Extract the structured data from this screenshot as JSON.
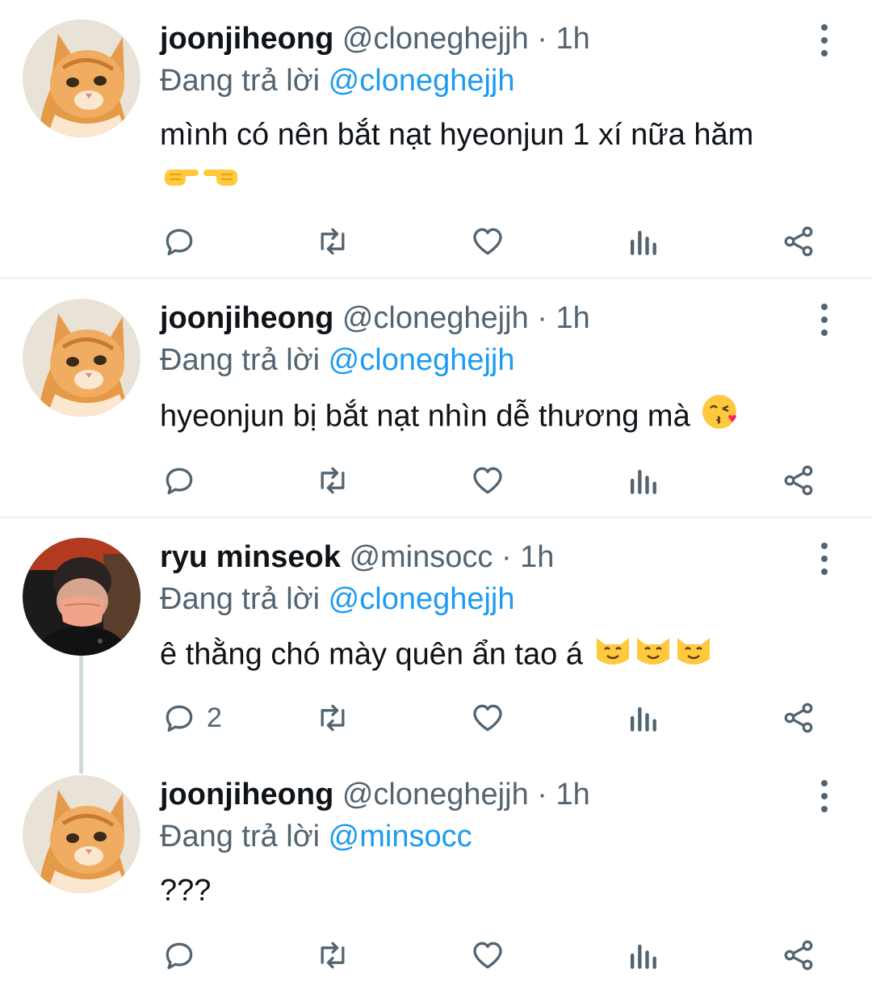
{
  "tweets": [
    {
      "name": "joonjiheong",
      "handle": "@cloneghejjh",
      "dot": "·",
      "time": "1h",
      "replying_prefix": "Đang trả lời",
      "replying_to": "@cloneghejjh",
      "text": "mình có nên bắt nạt hyeonjun 1 xí nữa hăm",
      "emoji": [
        "pointing-right-emoji",
        "pointing-left-emoji"
      ],
      "reply_count": ""
    },
    {
      "name": "joonjiheong",
      "handle": "@cloneghejjh",
      "dot": "·",
      "time": "1h",
      "replying_prefix": "Đang trả lời",
      "replying_to": "@cloneghejjh",
      "text": "hyeonjun bị bắt nạt nhìn dễ thương mà",
      "emoji": [
        "kissing-heart-emoji"
      ],
      "reply_count": ""
    },
    {
      "name": "ryu minseok",
      "handle": "@minsocc",
      "dot": "·",
      "time": "1h",
      "replying_prefix": "Đang trả lời",
      "replying_to": "@cloneghejjh",
      "text": "ê thằng chó mày quên ẩn tao á",
      "emoji": [
        "smiling-cat-emoji",
        "smiling-cat-emoji",
        "smiling-cat-emoji"
      ],
      "reply_count": "2"
    },
    {
      "name": "joonjiheong",
      "handle": "@cloneghejjh",
      "dot": "·",
      "time": "1h",
      "replying_prefix": "Đang trả lời",
      "replying_to": "@minsocc",
      "text": "???",
      "emoji": [],
      "reply_count": ""
    }
  ],
  "icons": {
    "reply": "reply-icon",
    "retweet": "retweet-icon",
    "like": "heart-icon",
    "views": "views-icon",
    "share": "share-icon",
    "more": "more-vertical-icon"
  },
  "colors": {
    "text": "#0f1419",
    "secondary": "#536471",
    "mention": "#1d9bf0",
    "divider": "#eff3f4",
    "thread_line": "#cfd9de"
  }
}
